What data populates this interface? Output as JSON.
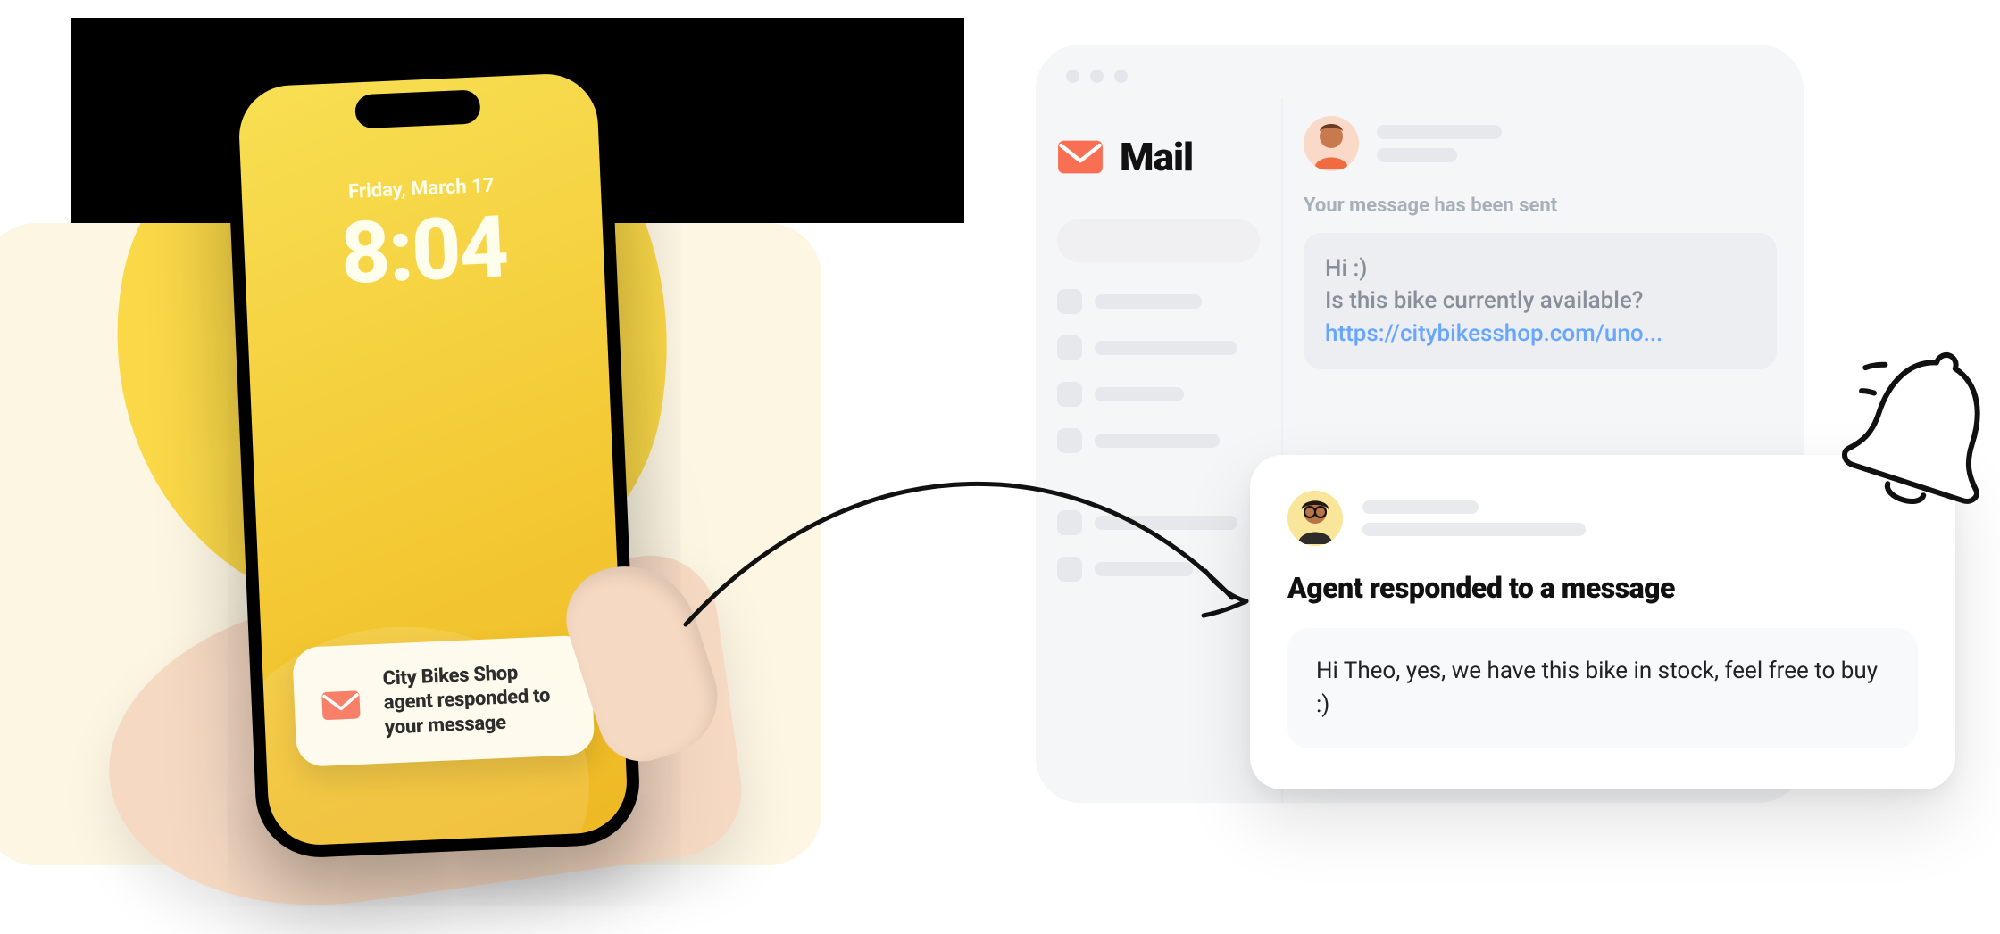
{
  "phone": {
    "date": "Friday, March 17",
    "time": "8:04",
    "notification": {
      "text": "City Bikes Shop agent responded to your message"
    }
  },
  "mail": {
    "title": "Mail",
    "sent_label": "Your message has been sent",
    "message_body": {
      "line1": "Hi :)",
      "line2": "Is this bike currently available?",
      "link": "https://citybikesshop.com/uno..."
    }
  },
  "desktop_notification": {
    "title": "Agent responded to a message",
    "body": "Hi Theo, yes, we have this bike in stock, feel free to buy :)"
  }
}
